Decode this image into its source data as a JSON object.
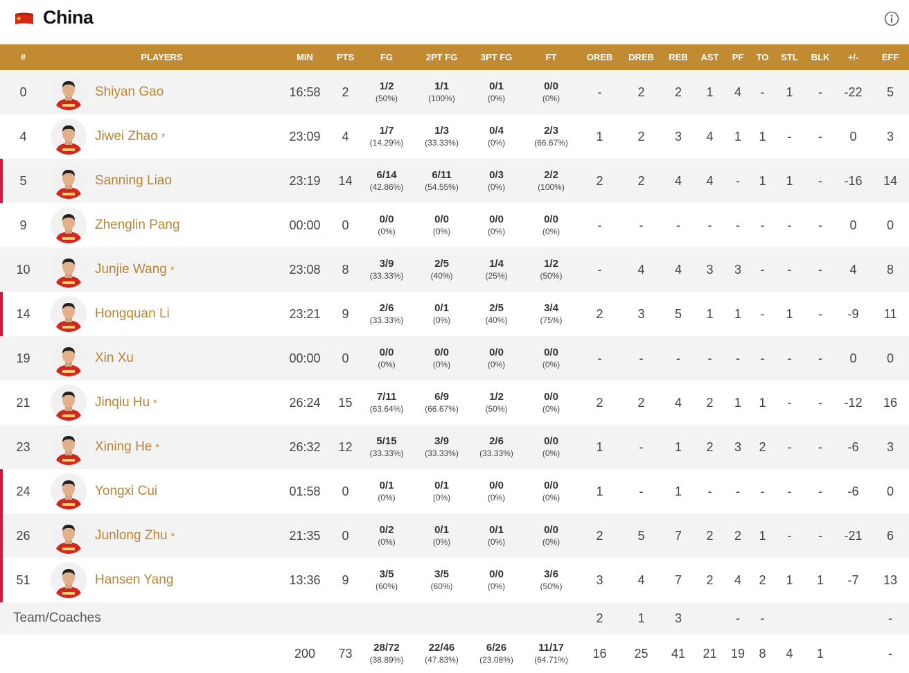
{
  "team": {
    "name": "China"
  },
  "colors": {
    "accent": "#c28a31",
    "player_link": "#b88436",
    "starter_marker": "#d6163a"
  },
  "icons": {
    "flag": "china-flag-icon",
    "info": "info-icon",
    "avatar": "player-photo"
  },
  "columns": [
    "#",
    "PLAYERS",
    "MIN",
    "PTS",
    "FG",
    "2PT FG",
    "3PT FG",
    "FT",
    "OREB",
    "DREB",
    "REB",
    "AST",
    "PF",
    "TO",
    "STL",
    "BLK",
    "+/-",
    "EFF"
  ],
  "players": [
    {
      "num": "0",
      "name": "Shiyan Gao",
      "star": "",
      "marked": false,
      "min": "16:58",
      "pts": "2",
      "fg": "1/2",
      "fg_pct": "(50%)",
      "fg2": "1/1",
      "fg2_pct": "(100%)",
      "fg3": "0/1",
      "fg3_pct": "(0%)",
      "ft": "0/0",
      "ft_pct": "(0%)",
      "oreb": "-",
      "dreb": "2",
      "reb": "2",
      "ast": "1",
      "pf": "4",
      "to": "-",
      "stl": "1",
      "blk": "-",
      "pm": "-22",
      "eff": "5"
    },
    {
      "num": "4",
      "name": "Jiwei Zhao",
      "star": "*",
      "marked": false,
      "min": "23:09",
      "pts": "4",
      "fg": "1/7",
      "fg_pct": "(14.29%)",
      "fg2": "1/3",
      "fg2_pct": "(33.33%)",
      "fg3": "0/4",
      "fg3_pct": "(0%)",
      "ft": "2/3",
      "ft_pct": "(66.67%)",
      "oreb": "1",
      "dreb": "2",
      "reb": "3",
      "ast": "4",
      "pf": "1",
      "to": "1",
      "stl": "-",
      "blk": "-",
      "pm": "0",
      "eff": "3"
    },
    {
      "num": "5",
      "name": "Sanning Liao",
      "star": "",
      "marked": true,
      "min": "23:19",
      "pts": "14",
      "fg": "6/14",
      "fg_pct": "(42.86%)",
      "fg2": "6/11",
      "fg2_pct": "(54.55%)",
      "fg3": "0/3",
      "fg3_pct": "(0%)",
      "ft": "2/2",
      "ft_pct": "(100%)",
      "oreb": "2",
      "dreb": "2",
      "reb": "4",
      "ast": "4",
      "pf": "-",
      "to": "1",
      "stl": "1",
      "blk": "-",
      "pm": "-16",
      "eff": "14"
    },
    {
      "num": "9",
      "name": "Zhenglin Pang",
      "star": "",
      "marked": false,
      "min": "00:00",
      "pts": "0",
      "fg": "0/0",
      "fg_pct": "(0%)",
      "fg2": "0/0",
      "fg2_pct": "(0%)",
      "fg3": "0/0",
      "fg3_pct": "(0%)",
      "ft": "0/0",
      "ft_pct": "(0%)",
      "oreb": "-",
      "dreb": "-",
      "reb": "-",
      "ast": "-",
      "pf": "-",
      "to": "-",
      "stl": "-",
      "blk": "-",
      "pm": "0",
      "eff": "0"
    },
    {
      "num": "10",
      "name": "Junjie Wang",
      "star": "*",
      "marked": false,
      "min": "23:08",
      "pts": "8",
      "fg": "3/9",
      "fg_pct": "(33.33%)",
      "fg2": "2/5",
      "fg2_pct": "(40%)",
      "fg3": "1/4",
      "fg3_pct": "(25%)",
      "ft": "1/2",
      "ft_pct": "(50%)",
      "oreb": "-",
      "dreb": "4",
      "reb": "4",
      "ast": "3",
      "pf": "3",
      "to": "-",
      "stl": "-",
      "blk": "-",
      "pm": "4",
      "eff": "8"
    },
    {
      "num": "14",
      "name": "Hongquan Li",
      "star": "",
      "marked": true,
      "min": "23:21",
      "pts": "9",
      "fg": "2/6",
      "fg_pct": "(33.33%)",
      "fg2": "0/1",
      "fg2_pct": "(0%)",
      "fg3": "2/5",
      "fg3_pct": "(40%)",
      "ft": "3/4",
      "ft_pct": "(75%)",
      "oreb": "2",
      "dreb": "3",
      "reb": "5",
      "ast": "1",
      "pf": "1",
      "to": "-",
      "stl": "1",
      "blk": "-",
      "pm": "-9",
      "eff": "11"
    },
    {
      "num": "19",
      "name": "Xin Xu",
      "star": "",
      "marked": false,
      "min": "00:00",
      "pts": "0",
      "fg": "0/0",
      "fg_pct": "(0%)",
      "fg2": "0/0",
      "fg2_pct": "(0%)",
      "fg3": "0/0",
      "fg3_pct": "(0%)",
      "ft": "0/0",
      "ft_pct": "(0%)",
      "oreb": "-",
      "dreb": "-",
      "reb": "-",
      "ast": "-",
      "pf": "-",
      "to": "-",
      "stl": "-",
      "blk": "-",
      "pm": "0",
      "eff": "0"
    },
    {
      "num": "21",
      "name": "Jinqiu Hu",
      "star": "*",
      "marked": false,
      "min": "26:24",
      "pts": "15",
      "fg": "7/11",
      "fg_pct": "(63.64%)",
      "fg2": "6/9",
      "fg2_pct": "(66.67%)",
      "fg3": "1/2",
      "fg3_pct": "(50%)",
      "ft": "0/0",
      "ft_pct": "(0%)",
      "oreb": "2",
      "dreb": "2",
      "reb": "4",
      "ast": "2",
      "pf": "1",
      "to": "1",
      "stl": "-",
      "blk": "-",
      "pm": "-12",
      "eff": "16"
    },
    {
      "num": "23",
      "name": "Xining He",
      "star": "*",
      "marked": false,
      "min": "26:32",
      "pts": "12",
      "fg": "5/15",
      "fg_pct": "(33.33%)",
      "fg2": "3/9",
      "fg2_pct": "(33.33%)",
      "fg3": "2/6",
      "fg3_pct": "(33.33%)",
      "ft": "0/0",
      "ft_pct": "(0%)",
      "oreb": "1",
      "dreb": "-",
      "reb": "1",
      "ast": "2",
      "pf": "3",
      "to": "2",
      "stl": "-",
      "blk": "-",
      "pm": "-6",
      "eff": "3"
    },
    {
      "num": "24",
      "name": "Yongxi Cui",
      "star": "",
      "marked": true,
      "min": "01:58",
      "pts": "0",
      "fg": "0/1",
      "fg_pct": "(0%)",
      "fg2": "0/1",
      "fg2_pct": "(0%)",
      "fg3": "0/0",
      "fg3_pct": "(0%)",
      "ft": "0/0",
      "ft_pct": "(0%)",
      "oreb": "1",
      "dreb": "-",
      "reb": "1",
      "ast": "-",
      "pf": "-",
      "to": "-",
      "stl": "-",
      "blk": "-",
      "pm": "-6",
      "eff": "0"
    },
    {
      "num": "26",
      "name": "Junlong Zhu",
      "star": "*",
      "marked": true,
      "min": "21:35",
      "pts": "0",
      "fg": "0/2",
      "fg_pct": "(0%)",
      "fg2": "0/1",
      "fg2_pct": "(0%)",
      "fg3": "0/1",
      "fg3_pct": "(0%)",
      "ft": "0/0",
      "ft_pct": "(0%)",
      "oreb": "2",
      "dreb": "5",
      "reb": "7",
      "ast": "2",
      "pf": "2",
      "to": "1",
      "stl": "-",
      "blk": "-",
      "pm": "-21",
      "eff": "6"
    },
    {
      "num": "51",
      "name": "Hansen Yang",
      "star": "",
      "marked": true,
      "min": "13:36",
      "pts": "9",
      "fg": "3/5",
      "fg_pct": "(60%)",
      "fg2": "3/5",
      "fg2_pct": "(60%)",
      "fg3": "0/0",
      "fg3_pct": "(0%)",
      "ft": "3/6",
      "ft_pct": "(50%)",
      "oreb": "3",
      "dreb": "4",
      "reb": "7",
      "ast": "2",
      "pf": "4",
      "to": "2",
      "stl": "1",
      "blk": "1",
      "pm": "-7",
      "eff": "13"
    }
  ],
  "team_row": {
    "label": "Team/Coaches",
    "oreb": "2",
    "dreb": "1",
    "reb": "3",
    "ast": "",
    "pf": "-",
    "to": "-",
    "stl": "",
    "blk": "",
    "pm": "",
    "eff": "-"
  },
  "totals": {
    "min": "200",
    "pts": "73",
    "fg": "28/72",
    "fg_pct": "(38.89%)",
    "fg2": "22/46",
    "fg2_pct": "(47.83%)",
    "fg3": "6/26",
    "fg3_pct": "(23.08%)",
    "ft": "11/17",
    "ft_pct": "(64.71%)",
    "oreb": "16",
    "dreb": "25",
    "reb": "41",
    "ast": "21",
    "pf": "19",
    "to": "8",
    "stl": "4",
    "blk": "1",
    "pm": "",
    "eff": "-"
  }
}
